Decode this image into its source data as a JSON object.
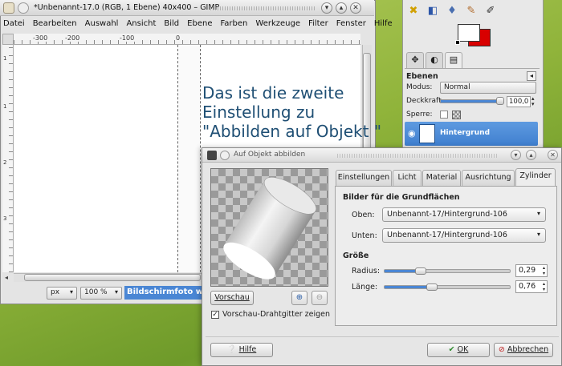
{
  "gimp": {
    "title": "*Unbenannt-17.0 (RGB, 1 Ebene) 40x400 – GIMP",
    "menu": [
      "Datei",
      "Bearbeiten",
      "Auswahl",
      "Ansicht",
      "Bild",
      "Ebene",
      "Farben",
      "Werkzeuge",
      "Filter",
      "Fenster",
      "Hilfe"
    ],
    "ruler_h": [
      "-300",
      "-200",
      "-100",
      "0"
    ],
    "ruler_v": [
      "1",
      "1",
      "2",
      "3"
    ],
    "unit": "px",
    "zoom": "100 %",
    "status": "Bildschirmfoto wird"
  },
  "annotation": {
    "line1": "Das ist die zweite",
    "line2": "Einstellung zu",
    "line3": "\"Abbilden auf Objekt \""
  },
  "dock": {
    "panel_title": "Ebenen",
    "modus_label": "Modus:",
    "modus_value": "Normal",
    "deckkraft_label": "Deckkraft",
    "deckkraft_value": "100,0",
    "sperre_label": "Sperre:",
    "layer_name": "Hintergrund"
  },
  "dialog": {
    "title": "Auf Objekt abbilden",
    "tabs": [
      "Einstellungen",
      "Licht",
      "Material",
      "Ausrichtung",
      "Zylinder"
    ],
    "active_tab": "Zylinder",
    "group_bilder": "Bilder für die Grundflächen",
    "oben_label": "Oben:",
    "oben_value": "Unbenannt-17/Hintergrund-106",
    "unten_label": "Unten:",
    "unten_value": "Unbenannt-17/Hintergrund-106",
    "group_groesse": "Größe",
    "radius_label": "Radius:",
    "radius_value": "0,29",
    "radius_fraction": 0.29,
    "laenge_label": "Länge:",
    "laenge_value": "0,76",
    "laenge_fraction": 0.38,
    "vorschau_button": "Vorschau",
    "wireframe_label": "Vorschau-Drahtgitter zeigen",
    "wireframe_checked": true,
    "help_button": "Hilfe",
    "ok_button": "OK",
    "cancel_button": "Abbrechen"
  }
}
